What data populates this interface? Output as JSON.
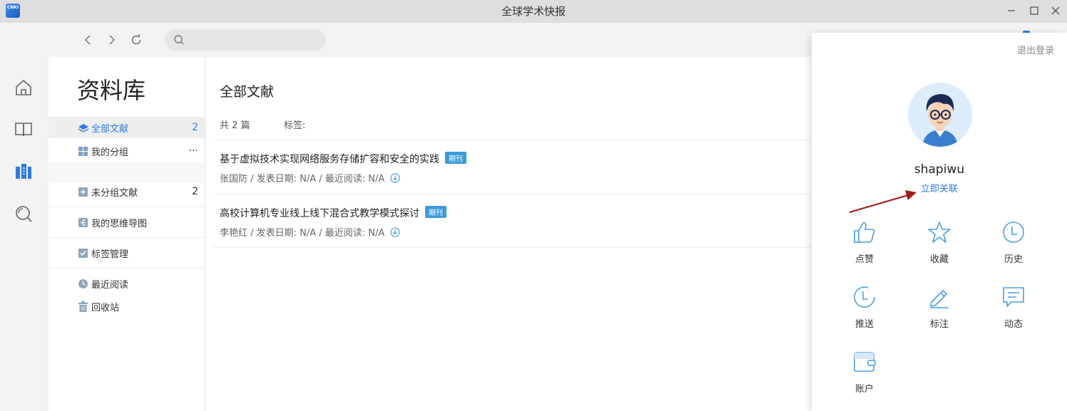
{
  "app": {
    "title": "全球学术快报",
    "logo_text": "CNKI"
  },
  "toolbar": {
    "search_placeholder": ""
  },
  "rail": {
    "items": [
      "home-icon",
      "book-icon",
      "library-icon",
      "discover-icon"
    ]
  },
  "library": {
    "title": "资料库",
    "items": [
      {
        "label": "全部文献",
        "count": "2"
      },
      {
        "label": "我的分组",
        "more": "···"
      },
      {
        "label": "未分组文献",
        "count": "2"
      },
      {
        "label": "我的思维导图"
      },
      {
        "label": "标签管理"
      },
      {
        "label": "最近阅读"
      },
      {
        "label": "回收站"
      }
    ]
  },
  "main": {
    "title": "全部文献",
    "count_text": "共 2 篇",
    "tag_label": "标签:",
    "docs": [
      {
        "title": "基于虚拟技术实现网络服务存储扩容和安全的实践",
        "badge": "期刊",
        "meta": "张国防 / 发表日期: N/A / 最近阅读: N/A"
      },
      {
        "title": "高校计算机专业线上线下混合式教学模式探讨",
        "badge": "期刊",
        "meta": "李艳红 / 发表日期: N/A / 最近阅读: N/A"
      }
    ]
  },
  "user_panel": {
    "logout": "退出登录",
    "username": "shapiwu",
    "link_now": "立即关联",
    "buttons": [
      {
        "label": "点赞",
        "icon": "thumbs-up-icon"
      },
      {
        "label": "收藏",
        "icon": "star-icon"
      },
      {
        "label": "历史",
        "icon": "clock-icon"
      },
      {
        "label": "推送",
        "icon": "push-clock-icon"
      },
      {
        "label": "标注",
        "icon": "pencil-icon"
      },
      {
        "label": "动态",
        "icon": "message-icon"
      },
      {
        "label": "账户",
        "icon": "wallet-icon"
      }
    ]
  },
  "colors": {
    "accent": "#2c7be5",
    "badge": "#3d9bdc",
    "icon_blue": "#4a9fe0",
    "arrow": "#a31c1c"
  }
}
